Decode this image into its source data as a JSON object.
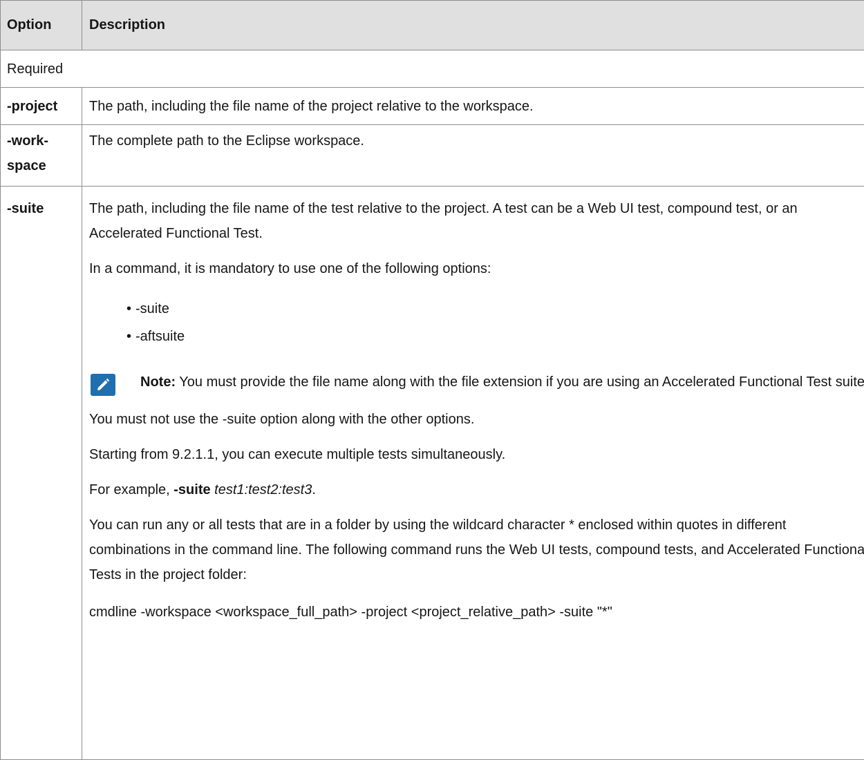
{
  "table": {
    "headers": {
      "option": "Option",
      "description": "Description"
    },
    "section": "Required",
    "rows": {
      "project": {
        "option": "-project",
        "description": "The path, including the file name of the project relative to the workspace."
      },
      "workspace": {
        "option_line1": "-work-",
        "option_line2": "space",
        "description": "The complete path to the Eclipse workspace."
      },
      "suite": {
        "option": "-suite",
        "para1": "The path, including the file name of the test relative to the project. A test can be a Web UI test, compound test, or an Accelerated Functional Test.",
        "para2": "In a command, it is mandatory to use one of the following options:",
        "bullets": [
          "-suite",
          "-aftsuite"
        ],
        "note_label": "Note:",
        "note_text": " You must provide the file name along with the file extension if you are using an Accelerated Functional Test suite.",
        "para3": "You must not use the -suite option along with the other options.",
        "para4": "Starting from 9.2.1.1, you can execute multiple tests simultaneously.",
        "example_prefix": "For example, ",
        "example_option": "-suite",
        "example_value": "test1:test2:test3",
        "example_suffix": ".",
        "para5": "You can run any or all tests that are in a folder by using the wildcard character * enclosed within quotes in different combinations in the command line. The following command runs the Web UI tests, compound tests, and Accelerated Functional Tests in the project folder:",
        "command": "cmdline -workspace <workspace_full_path> -project <project_relative_path> -suite \"*\""
      }
    }
  },
  "icons": {
    "note": "pencil-note-icon"
  },
  "colors": {
    "header_bg": "#e0e0e0",
    "border": "#8d8d8d",
    "note_icon": "#1f6fb0"
  }
}
